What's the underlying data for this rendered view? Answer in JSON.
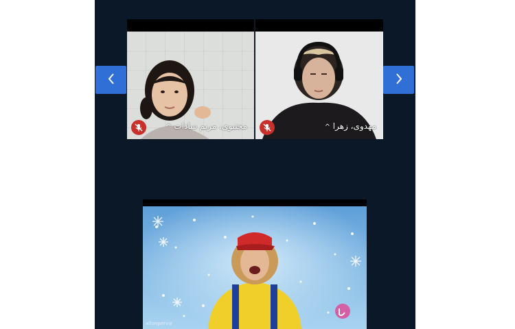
{
  "participants": [
    {
      "name": "مجتبوی، مریم سادات",
      "caret": "^",
      "muted": true
    },
    {
      "name": "مهدوی، زهرا",
      "caret": "^",
      "muted": true
    }
  ],
  "navigation": {
    "prev_icon": "chevron-left-icon",
    "next_icon": "chevron-right-icon"
  },
  "shared_video": {
    "watermark": "alfonperviz"
  },
  "colors": {
    "app_background": "#0b1828",
    "nav_button": "#2f6fd6",
    "mute_badge": "#c9302c"
  }
}
